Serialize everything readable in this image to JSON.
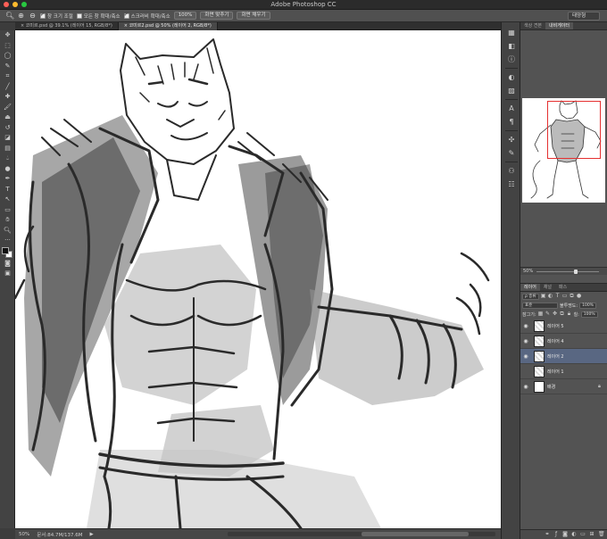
{
  "window": {
    "title": "Adobe Photoshop CC"
  },
  "options_bar": {
    "zoom_checks": [
      {
        "label": "창 크기 조절",
        "checked": true
      },
      {
        "label": "모든 창 확대/축소",
        "checked": false
      },
      {
        "label": "스크러비 확대/축소",
        "checked": true
      }
    ],
    "zoom_percent": "100%",
    "fit_screen_label": "화면 맞추기",
    "fill_screen_label": "화면 채우기",
    "workspace": "태양형"
  },
  "tabs": [
    {
      "label": "코미르.psd @ 39.1% (레이어 15, RGB/8*)",
      "active": false,
      "close": "×"
    },
    {
      "label": "코미르2.psd @ 50% (레이어 2, RGB/8*)",
      "active": true,
      "close": "×"
    }
  ],
  "status": {
    "zoom": "50%",
    "doc": "문서:84.7M/137.6M",
    "arrow": "▶"
  },
  "navigator": {
    "tabs": [
      "색상 견본",
      "내비게이터"
    ],
    "active_tab": 1,
    "zoom": "50%"
  },
  "layers_panel": {
    "tabs": [
      "레이어",
      "채널",
      "패스"
    ],
    "kind_label": "ρ 종류",
    "blend_mode": "표준",
    "opacity_label": "불투명도:",
    "opacity": "100%",
    "lock_label": "잠그기:",
    "fill_label": "칠:",
    "fill": "100%",
    "layers": [
      {
        "name": "레이어 5",
        "selected": false,
        "bg": false
      },
      {
        "name": "레이어 4",
        "selected": false,
        "bg": false
      },
      {
        "name": "레이어 2",
        "selected": true,
        "bg": false
      },
      {
        "name": "레이어 1",
        "selected": false,
        "bg": false
      },
      {
        "name": "배경",
        "selected": false,
        "bg": true
      }
    ]
  },
  "colors": {
    "close": "#fe5f57",
    "minimize": "#febc2e",
    "maximize": "#28c840",
    "selection": "#596782",
    "nav_view_rect": "#e53030"
  }
}
